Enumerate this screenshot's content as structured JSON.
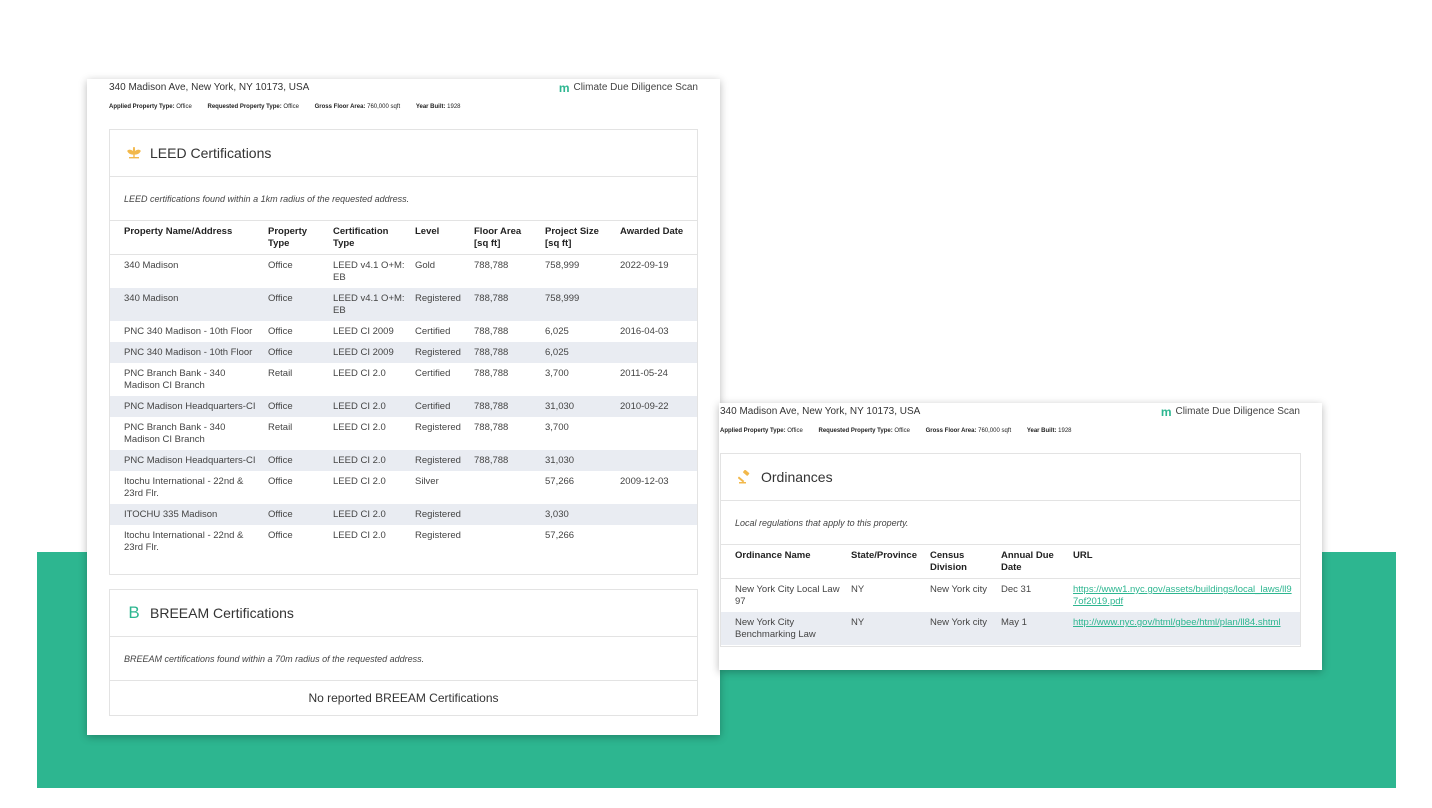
{
  "left_sheet": {
    "address": "340 Madison Ave, New York, NY 10173, USA",
    "brand": "Climate Due Diligence Scan",
    "meta": [
      {
        "label": "Applied Property Type:",
        "value": "Office"
      },
      {
        "label": "Requested Property Type:",
        "value": "Office"
      },
      {
        "label": "Gross Floor Area:",
        "value": "760,000 sqft"
      },
      {
        "label": "Year Built:",
        "value": "1928"
      }
    ],
    "leed": {
      "title": "LEED Certifications",
      "description": "LEED certifications found within a 1km radius of the requested address.",
      "columns": [
        "Property Name/Address",
        "Property Type",
        "Certification Type",
        "Level",
        "Floor Area [sq ft]",
        "Project Size [sq ft]",
        "Awarded Date"
      ],
      "rows": [
        [
          "340 Madison",
          "Office",
          "LEED v4.1 O+M: EB",
          "Gold",
          "788,788",
          "758,999",
          "2022-09-19"
        ],
        [
          "340 Madison",
          "Office",
          "LEED v4.1 O+M: EB",
          "Registered",
          "788,788",
          "758,999",
          ""
        ],
        [
          "PNC 340 Madison - 10th Floor",
          "Office",
          "LEED CI 2009",
          "Certified",
          "788,788",
          "6,025",
          "2016-04-03"
        ],
        [
          "PNC 340 Madison - 10th Floor",
          "Office",
          "LEED CI 2009",
          "Registered",
          "788,788",
          "6,025",
          ""
        ],
        [
          "PNC Branch Bank - 340 Madison CI Branch",
          "Retail",
          "LEED CI 2.0",
          "Certified",
          "788,788",
          "3,700",
          "2011-05-24"
        ],
        [
          "PNC Madison Headquarters-CI",
          "Office",
          "LEED CI 2.0",
          "Certified",
          "788,788",
          "31,030",
          "2010-09-22"
        ],
        [
          "PNC Branch Bank - 340 Madison CI Branch",
          "Retail",
          "LEED CI 2.0",
          "Registered",
          "788,788",
          "3,700",
          ""
        ],
        [
          "PNC Madison Headquarters-CI",
          "Office",
          "LEED CI 2.0",
          "Registered",
          "788,788",
          "31,030",
          ""
        ],
        [
          "Itochu International - 22nd & 23rd Flr.",
          "Office",
          "LEED CI 2.0",
          "Silver",
          "",
          "57,266",
          "2009-12-03"
        ],
        [
          "ITOCHU 335 Madison",
          "Office",
          "LEED CI 2.0",
          "Registered",
          "",
          "3,030",
          ""
        ],
        [
          "Itochu International - 22nd & 23rd Flr.",
          "Office",
          "LEED CI 2.0",
          "Registered",
          "",
          "57,266",
          ""
        ]
      ]
    },
    "breeam": {
      "title": "BREEAM Certifications",
      "description": "BREEAM certifications found within a 70m radius of the requested address.",
      "empty": "No reported BREEAM Certifications"
    }
  },
  "right_sheet": {
    "address": "340 Madison Ave, New York, NY 10173, USA",
    "brand": "Climate Due Diligence Scan",
    "meta": [
      {
        "label": "Applied Property Type:",
        "value": "Office"
      },
      {
        "label": "Requested Property Type:",
        "value": "Office"
      },
      {
        "label": "Gross Floor Area:",
        "value": "760,000 sqft"
      },
      {
        "label": "Year Built:",
        "value": "1928"
      }
    ],
    "ordinances": {
      "title": "Ordinances",
      "description": "Local regulations that apply to this property.",
      "columns": [
        "Ordinance Name",
        "State/Province",
        "Census Division",
        "Annual Due Date",
        "URL"
      ],
      "rows": [
        [
          "New York City Local Law 97",
          "NY",
          "New York city",
          "Dec 31",
          "https://www1.nyc.gov/assets/buildings/local_laws/ll97of2019.pdf"
        ],
        [
          "New York City Benchmarking Law",
          "NY",
          "New York city",
          "May 1",
          "http://www.nyc.gov/html/gbee/html/plan/ll84.shtml"
        ]
      ]
    }
  },
  "colors": {
    "accent": "#2db690",
    "alt_row": "#e9ecf2",
    "leed_icon": "#f2b84b",
    "gavel_icon": "#f2b84b"
  },
  "icons": {
    "brand": "m-logo-icon",
    "leed": "leaf-icon",
    "breeam": "breeam-b-icon",
    "ordinances": "gavel-icon"
  }
}
